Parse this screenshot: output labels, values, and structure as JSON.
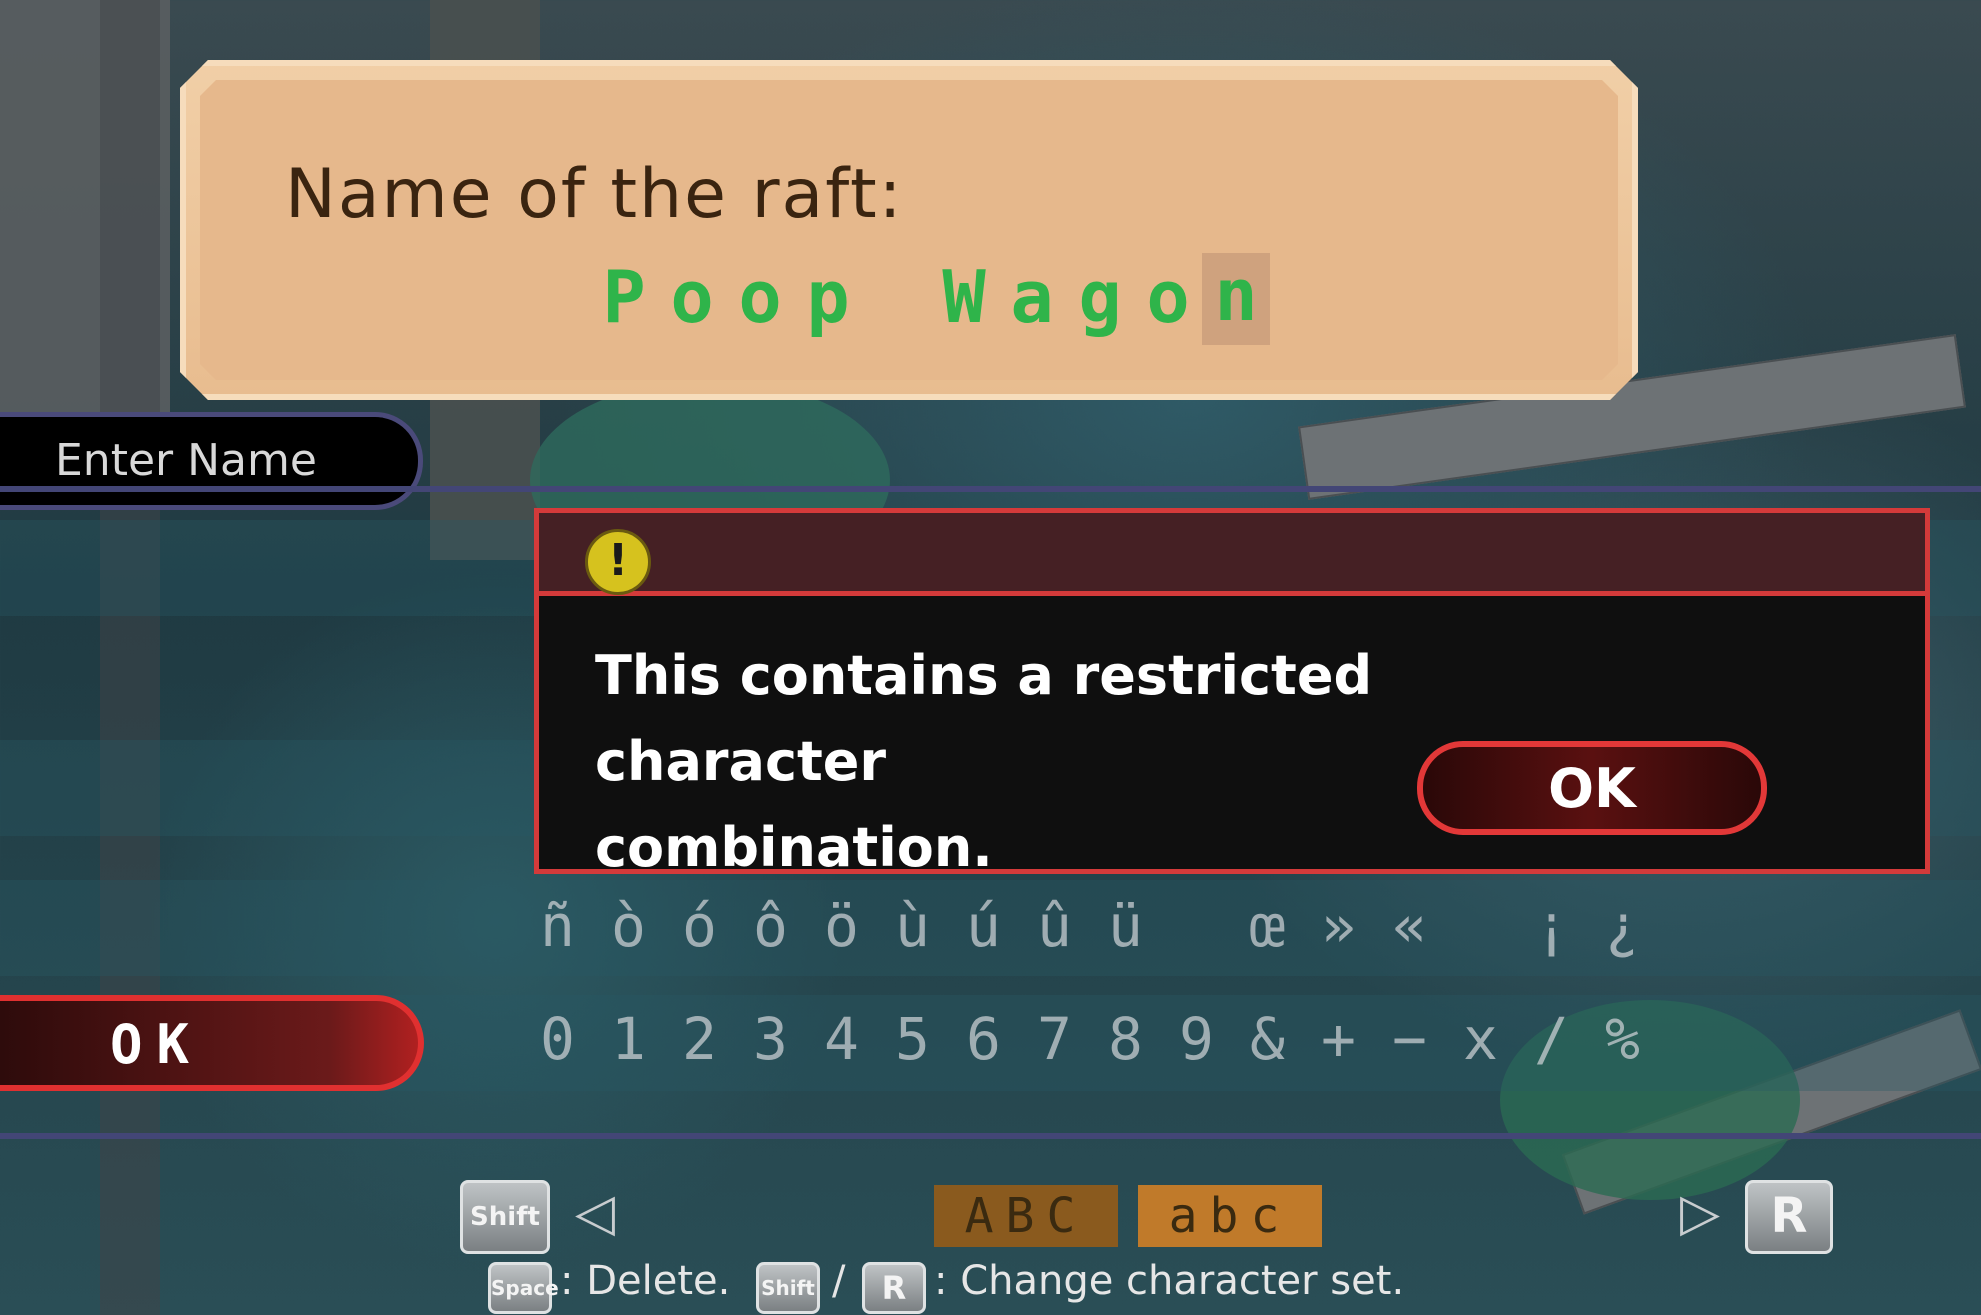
{
  "name_box": {
    "label": "Name of the raft:",
    "value_chars": [
      "P",
      "o",
      "o",
      "p",
      " ",
      "W",
      "a",
      "g",
      "o",
      "n"
    ]
  },
  "enter_tab": {
    "label": "Enter Name"
  },
  "char_rows": {
    "row1": [
      "ñ",
      "ò",
      "ó",
      "ô",
      "ö",
      "ù",
      "ú",
      "û",
      "ü",
      " ",
      "œ",
      "»",
      "«",
      " ",
      "¡",
      "¿"
    ],
    "row2": [
      "0",
      "1",
      "2",
      "3",
      "4",
      "5",
      "6",
      "7",
      "8",
      "9",
      "&",
      "+",
      "−",
      "x",
      "/",
      "%"
    ]
  },
  "ok_left": {
    "label": "OK"
  },
  "modal": {
    "icon": "exclamation-icon",
    "message_line1": "This contains a restricted character",
    "message_line2": "combination.",
    "ok_label": "OK"
  },
  "bottom": {
    "shift_key": "Shift",
    "r_key": "R",
    "tab_upper": "ABC",
    "tab_lower": "abc",
    "space_key": "Space",
    "delete_text": ": Delete.",
    "shift_key_small": "Shift",
    "slash": "/",
    "r_key_small": "R",
    "change_text": ": Change character set."
  },
  "colors": {
    "name_text": "#2fb44a",
    "modal_border": "#d43a3a",
    "tab_active": "#8a5a1e",
    "tab_inactive": "#c07a2a"
  }
}
